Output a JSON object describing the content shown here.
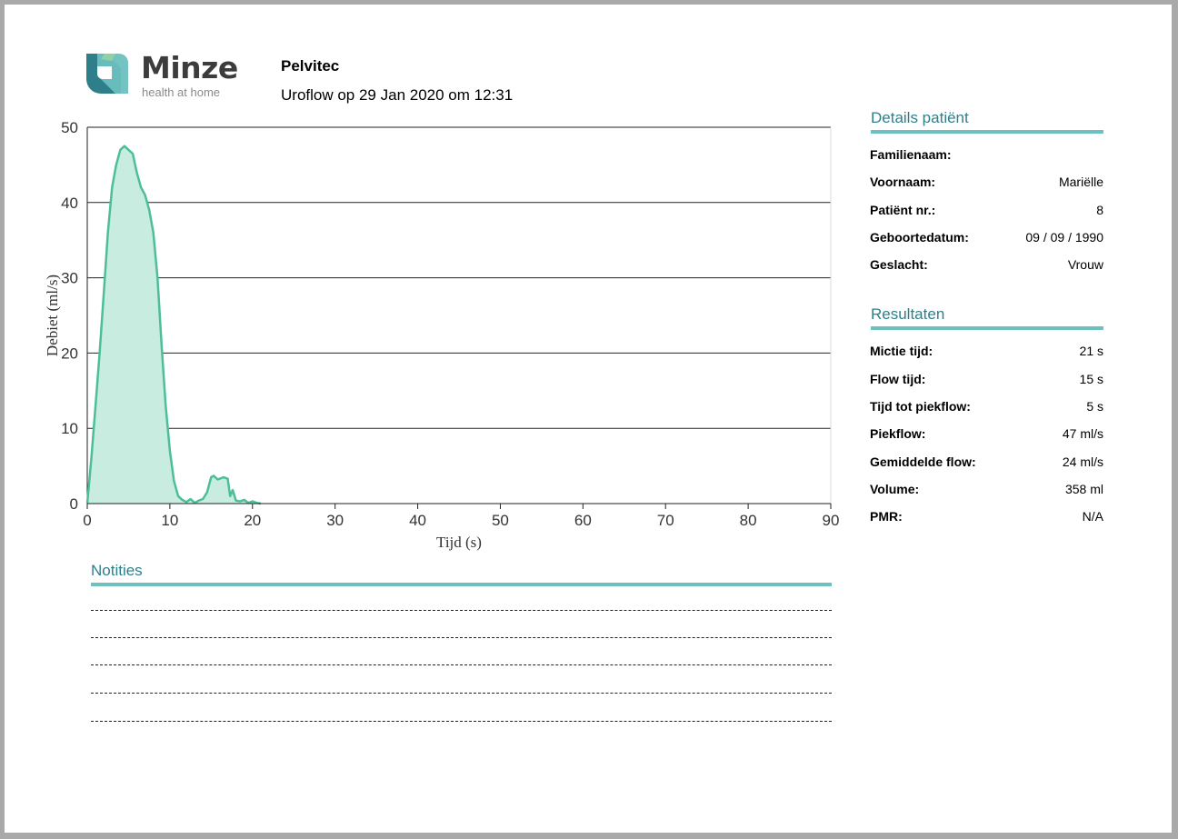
{
  "logo": {
    "name": "Minze",
    "tagline": "health at home"
  },
  "header": {
    "clinic": "Pelvitec",
    "subtitle": "Uroflow op 29 Jan 2020 om 12:31"
  },
  "patient": {
    "title": "Details patiënt",
    "rows": [
      {
        "label": "Familienaam:",
        "value": ""
      },
      {
        "label": "Voornaam:",
        "value": "Mariëlle"
      },
      {
        "label": "Patiënt nr.:",
        "value": "8"
      },
      {
        "label": "Geboortedatum:",
        "value": "09 / 09 / 1990"
      },
      {
        "label": "Geslacht:",
        "value": "Vrouw"
      }
    ]
  },
  "results": {
    "title": "Resultaten",
    "rows": [
      {
        "label": "Mictie tijd:",
        "value": "21 s"
      },
      {
        "label": "Flow tijd:",
        "value": "15 s"
      },
      {
        "label": "Tijd tot piekflow:",
        "value": "5 s"
      },
      {
        "label": "Piekflow:",
        "value": "47 ml/s"
      },
      {
        "label": "Gemiddelde flow:",
        "value": "24 ml/s"
      },
      {
        "label": "Volume:",
        "value": "358 ml"
      },
      {
        "label": "PMR:",
        "value": "N/A"
      }
    ]
  },
  "notes": {
    "title": "Notities"
  },
  "colors": {
    "accent": "#6cc0bf",
    "heading": "#2f7f8a",
    "flow_line": "#4cbf95",
    "flow_fill": "#c9ece0"
  },
  "chart_data": {
    "type": "area",
    "xlabel": "Tijd (s)",
    "ylabel": "Debiet (ml/s)",
    "xlim": [
      0,
      90
    ],
    "ylim": [
      0,
      50
    ],
    "xticks": [
      0,
      10,
      20,
      30,
      40,
      50,
      60,
      70,
      80,
      90
    ],
    "yticks": [
      0,
      10,
      20,
      30,
      40,
      50
    ],
    "grid": "horizontal",
    "x": [
      0,
      0.5,
      1,
      1.5,
      2,
      2.5,
      3,
      3.5,
      4,
      4.5,
      5,
      5.5,
      6,
      6.5,
      7,
      7.5,
      8,
      8.5,
      9,
      9.5,
      10,
      10.5,
      11,
      11.5,
      12,
      12.5,
      13,
      13.5,
      14,
      14.5,
      15,
      15.3,
      15.8,
      16.5,
      17,
      17.3,
      17.6,
      18,
      18.5,
      19,
      19.5,
      20,
      20.5,
      21
    ],
    "y": [
      0,
      6,
      13,
      20,
      28,
      36,
      42,
      45,
      47,
      47.5,
      47,
      46.5,
      44,
      42,
      41,
      39,
      36,
      30,
      21,
      13,
      7,
      3,
      1,
      0.5,
      0.2,
      0.6,
      0.1,
      0.4,
      0.6,
      1.5,
      3.5,
      3.7,
      3.2,
      3.5,
      3.3,
      1,
      1.8,
      0.4,
      0.3,
      0.5,
      0.1,
      0.3,
      0.1,
      0
    ]
  }
}
